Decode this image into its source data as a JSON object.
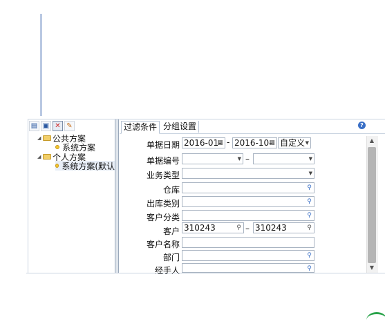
{
  "toolbar": {
    "save_icon": "save-icon",
    "saveas_icon": "save-as-icon",
    "delete_icon": "delete-icon",
    "edit_icon": "edit-icon"
  },
  "tree": {
    "public": {
      "label": "公共方案",
      "child": "系统方案"
    },
    "personal": {
      "label": "个人方案",
      "child": "系统方案(默认"
    }
  },
  "tabs": {
    "filter": "过滤条件",
    "group": "分组设置"
  },
  "help": "?",
  "form": {
    "date": {
      "label": "单据日期",
      "from": "2016-01-",
      "to": "2016-10-",
      "mode": "自定义"
    },
    "docno": {
      "label": "单据编号",
      "sep": "–"
    },
    "biztype": {
      "label": "业务类型"
    },
    "warehouse": {
      "label": "仓库"
    },
    "outtype": {
      "label": "出库类别"
    },
    "custclass": {
      "label": "客户分类"
    },
    "customer": {
      "label": "客户",
      "from": "310243",
      "to": "310243",
      "sep": "–"
    },
    "custname": {
      "label": "客户名称"
    },
    "dept": {
      "label": "部门"
    },
    "handler": {
      "label": "经手人"
    }
  }
}
